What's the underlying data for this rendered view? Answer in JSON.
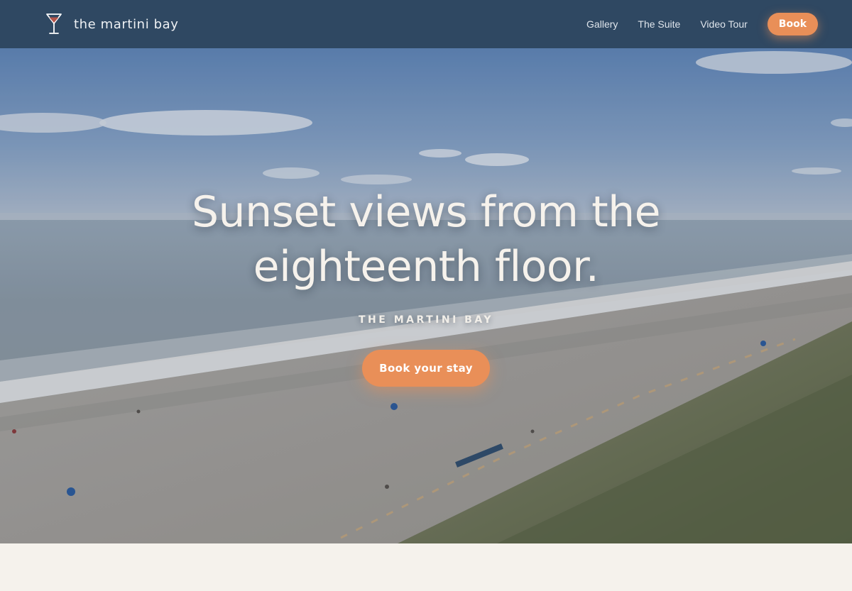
{
  "nav": {
    "brand_name": "the martini bay",
    "brand_icon": "martini-glass-icon",
    "links": [
      {
        "label": "Gallery"
      },
      {
        "label": "The Suite"
      },
      {
        "label": "Video Tour"
      }
    ],
    "book_label": "Book"
  },
  "hero": {
    "title": "Sunset views from the eighteenth floor.",
    "kicker": "THE MARTINI BAY",
    "cta_label": "Book your stay"
  },
  "colors": {
    "nav_bg": "#2f4862",
    "accent": "#e98f58",
    "page_bg": "#f5f2ec"
  }
}
